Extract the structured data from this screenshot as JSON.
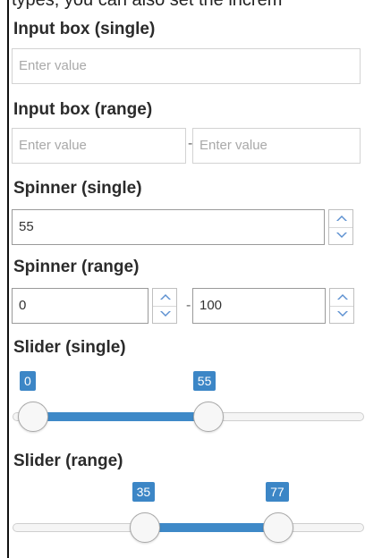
{
  "top_text": "types, you can also set the increm",
  "sections": {
    "input_single": {
      "title": "Input box (single)",
      "placeholder": "Enter value"
    },
    "input_range": {
      "title": "Input box (range)",
      "min_placeholder": "Enter value",
      "max_placeholder": "Enter value",
      "separator": "-"
    },
    "spinner_single": {
      "title": "Spinner (single)",
      "value": "55"
    },
    "spinner_range": {
      "title": "Spinner (range)",
      "min_value": "0",
      "max_value": "100",
      "separator": "-"
    },
    "slider_single": {
      "title": "Slider (single)",
      "min_label": "0",
      "value_label": "55",
      "value": 55,
      "min": 0,
      "max": 100
    },
    "slider_range": {
      "title": "Slider (range)",
      "low_label": "35",
      "high_label": "77",
      "low": 35,
      "high": 77,
      "min": 0,
      "max": 100
    }
  },
  "colors": {
    "accent": "#3c86c6",
    "arrow": "#5b8fd0"
  }
}
